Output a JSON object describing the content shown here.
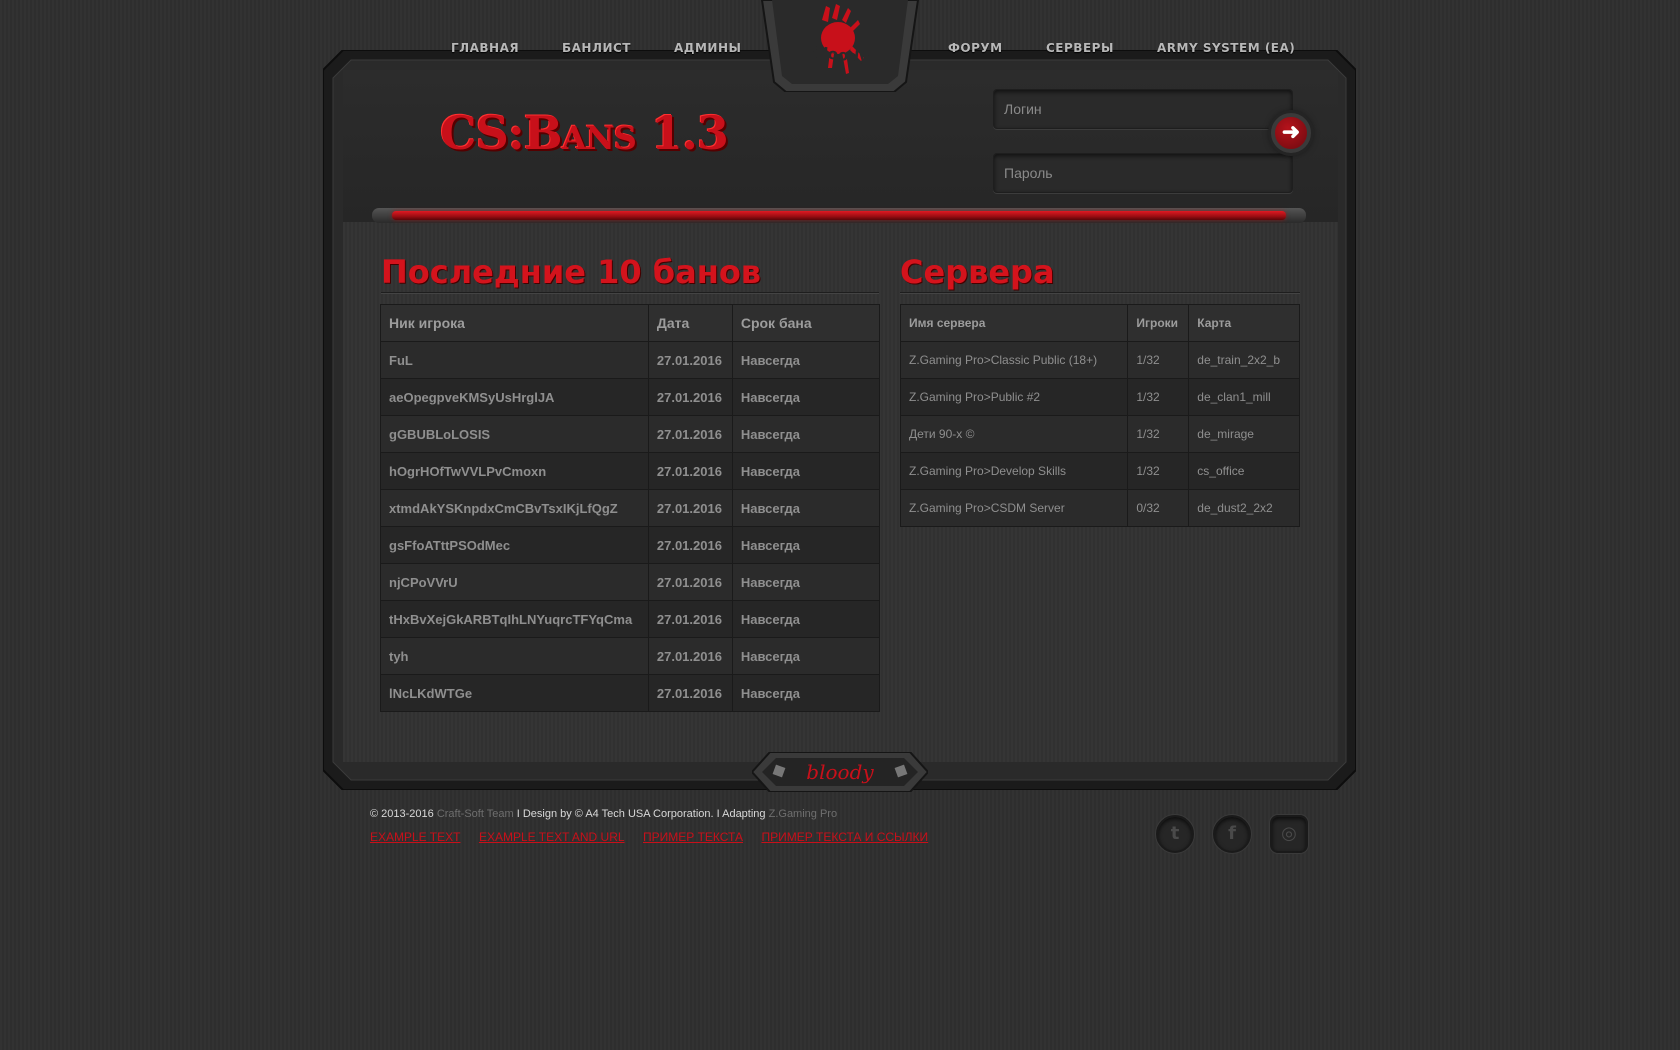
{
  "nav": {
    "items": [
      {
        "label": "ГЛАВНАЯ"
      },
      {
        "label": "БАНЛИСТ"
      },
      {
        "label": "АДМИНЫ"
      },
      {
        "label": "ФОРУМ"
      },
      {
        "label": "СЕРВЕРЫ"
      },
      {
        "label": "ARMY SYSTEM (EA)"
      }
    ]
  },
  "header": {
    "title": "CS:Bans 1.3",
    "login_placeholder": "Логин",
    "password_placeholder": "Пароль",
    "submit_icon": "arrow-right-icon"
  },
  "bans": {
    "heading": "Последние 10 банов",
    "columns": [
      "Ник игрока",
      "Дата",
      "Срок бана"
    ],
    "rows": [
      [
        "FuL",
        "27.01.2016",
        "Навсегда"
      ],
      [
        "aeOpegpveKMSyUsHrglJA",
        "27.01.2016",
        "Навсегда"
      ],
      [
        "gGBUBLoLOSIS",
        "27.01.2016",
        "Навсегда"
      ],
      [
        "hOgrHOfTwVVLPvCmoxn",
        "27.01.2016",
        "Навсегда"
      ],
      [
        "xtmdAkYSKnpdxCmCBvTsxIKjLfQgZ",
        "27.01.2016",
        "Навсегда"
      ],
      [
        "gsFfoATttPSOdMec",
        "27.01.2016",
        "Навсегда"
      ],
      [
        "njCPoVVrU",
        "27.01.2016",
        "Навсегда"
      ],
      [
        "tHxBvXejGkARBTqIhLNYuqrcTFYqCma",
        "27.01.2016",
        "Навсегда"
      ],
      [
        "tyh",
        "27.01.2016",
        "Навсегда"
      ],
      [
        "lNcLKdWTGe",
        "27.01.2016",
        "Навсегда"
      ]
    ]
  },
  "servers": {
    "heading": "Сервера",
    "columns": [
      "Имя сервера",
      "Игроки",
      "Карта"
    ],
    "rows": [
      [
        "Z.Gaming Pro>Classic Public (18+)",
        "1/32",
        "de_train_2x2_b"
      ],
      [
        "Z.Gaming Pro>Public #2",
        "1/32",
        "de_clan1_mill"
      ],
      [
        "Дети 90-х ©",
        "1/32",
        "de_mirage"
      ],
      [
        "Z.Gaming Pro>Develop Skills",
        "1/32",
        "cs_office"
      ],
      [
        "Z.Gaming Pro>CSDM Server",
        "0/32",
        "de_dust2_2x2"
      ]
    ]
  },
  "footer": {
    "copyright_prefix": "© 2013-2016 ",
    "team": "Craft-Soft Team",
    "design_text": " I Design by © A4 Tech USA Corporation. I Adapting ",
    "adapter": "Z.Gaming Pro",
    "links": [
      "EXAMPLE TEXT",
      "EXAMPLE TEXT AND URL",
      "ПРИМЕР ТЕКСТА",
      "ПРИМЕР ТЕКСТА И ССЫЛКИ"
    ],
    "social_icons": [
      "twitter-icon",
      "facebook-icon",
      "instagram-icon"
    ]
  },
  "colors": {
    "accent_red": "#c8101a",
    "background": "#303030"
  }
}
